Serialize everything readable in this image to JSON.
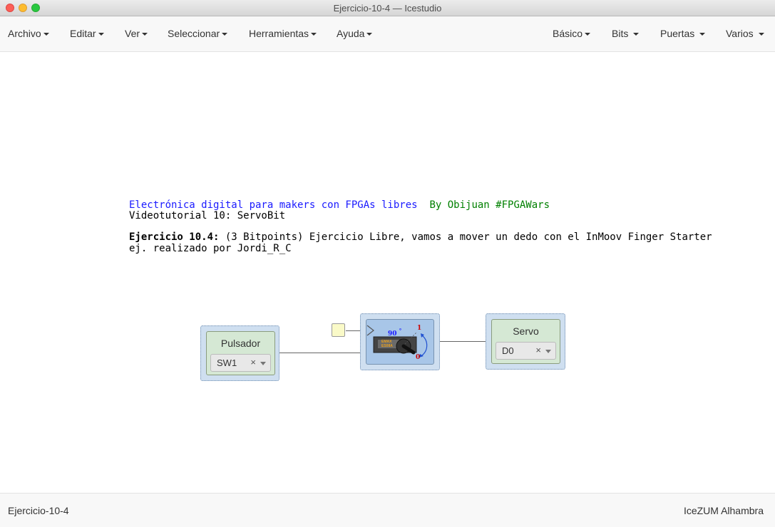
{
  "window": {
    "title": "Ejercicio-10-4 — Icestudio"
  },
  "menu_left": [
    "Archivo",
    "Editar",
    "Ver",
    "Seleccionar",
    "Herramientas",
    "Ayuda"
  ],
  "menu_right": [
    "Básico",
    "Bits",
    "Puertas",
    "Varios"
  ],
  "note": {
    "line1_blue": "Electrónica digital para makers con FPGAs libres",
    "line1_green": "By Obijuan #FPGAWars",
    "line2": "Videotutorial 10: ServoBit",
    "line3_bold": "Ejercicio 10.4:",
    "line3_rest": " (3 Bitpoints) Ejercicio Libre, vamos a mover un dedo con el InMoov Finger Starter",
    "line4": "ej. realizado por Jordi_R_C"
  },
  "blocks": {
    "pulsador": {
      "name": "Pulsador",
      "value": "SW1",
      "clear": "×"
    },
    "servo": {
      "name": "Servo",
      "value": "D0",
      "clear": "×"
    },
    "servobit": {
      "angle_label": "90",
      "degree": "°",
      "label_one": "1",
      "label_zero": "0",
      "chip_text1": "EMAX",
      "chip_text2": "ES08A"
    }
  },
  "status": {
    "file": "Ejercicio-10-4",
    "board": "IceZUM Alhambra"
  },
  "colors": {
    "block_bg": "#cfdff0",
    "io_bg": "#d5e8d4",
    "note_blue": "#1a1aff",
    "note_green": "#008000"
  }
}
